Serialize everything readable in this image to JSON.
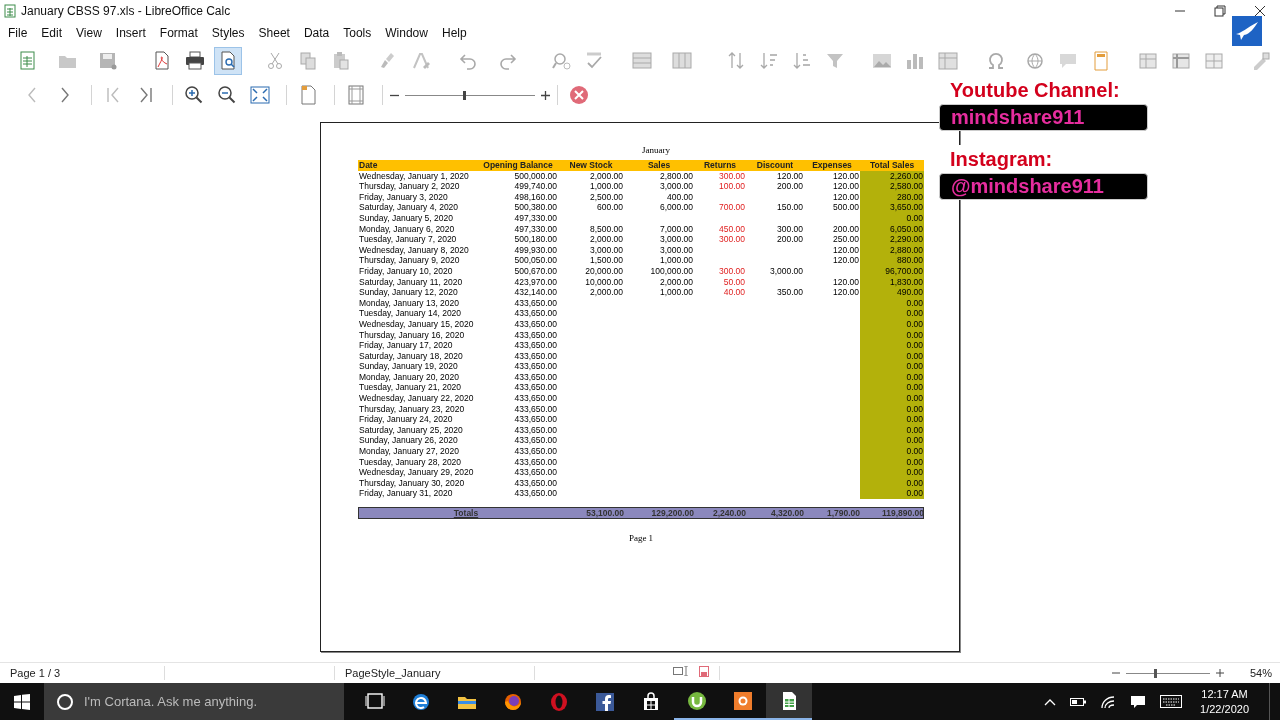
{
  "window": {
    "title": "January CBSS 97.xls - LibreOffice Calc"
  },
  "menu": [
    "File",
    "Edit",
    "View",
    "Insert",
    "Format",
    "Styles",
    "Sheet",
    "Data",
    "Tools",
    "Window",
    "Help"
  ],
  "zoom_toolbar": {
    "level": 0.45
  },
  "preview": {
    "sheet_title": "January",
    "columns": [
      "Date",
      "Opening Balance",
      "New Stock",
      "Sales",
      "Returns",
      "Discount",
      "Expenses",
      "Total Sales"
    ],
    "rows": [
      {
        "date": "Wednesday, January 1, 2020",
        "opening": "500,000.00",
        "new_stock": "2,000.00",
        "sales": "2,800.00",
        "returns": "300.00",
        "discount": "120.00",
        "expenses": "120.00",
        "total": "2,260.00"
      },
      {
        "date": "Thursday, January 2, 2020",
        "opening": "499,740.00",
        "new_stock": "1,000.00",
        "sales": "3,000.00",
        "returns": "100.00",
        "discount": "200.00",
        "expenses": "120.00",
        "total": "2,580.00"
      },
      {
        "date": "Friday, January 3, 2020",
        "opening": "498,160.00",
        "new_stock": "2,500.00",
        "sales": "400.00",
        "expenses": "120.00",
        "total": "280.00"
      },
      {
        "date": "Saturday, January 4, 2020",
        "opening": "500,380.00",
        "new_stock": "600.00",
        "sales": "6,000.00",
        "returns": "700.00",
        "discount": "150.00",
        "expenses": "500.00",
        "total": "3,650.00"
      },
      {
        "date": "Sunday, January 5, 2020",
        "opening": "497,330.00",
        "total": "0.00"
      },
      {
        "date": "Monday, January 6, 2020",
        "opening": "497,330.00",
        "new_stock": "8,500.00",
        "sales": "7,000.00",
        "returns": "450.00",
        "discount": "300.00",
        "expenses": "200.00",
        "total": "6,050.00"
      },
      {
        "date": "Tuesday, January 7, 2020",
        "opening": "500,180.00",
        "new_stock": "2,000.00",
        "sales": "3,000.00",
        "returns": "300.00",
        "discount": "200.00",
        "expenses": "250.00",
        "total": "2,290.00"
      },
      {
        "date": "Wednesday, January 8, 2020",
        "opening": "499,930.00",
        "new_stock": "3,000.00",
        "sales": "3,000.00",
        "expenses": "120.00",
        "total": "2,880.00"
      },
      {
        "date": "Thursday, January 9, 2020",
        "opening": "500,050.00",
        "new_stock": "1,500.00",
        "sales": "1,000.00",
        "expenses": "120.00",
        "total": "880.00"
      },
      {
        "date": "Friday, January 10, 2020",
        "opening": "500,670.00",
        "new_stock": "20,000.00",
        "sales": "100,000.00",
        "returns": "300.00",
        "discount": "3,000.00",
        "total": "96,700.00"
      },
      {
        "date": "Saturday, January 11, 2020",
        "opening": "423,970.00",
        "new_stock": "10,000.00",
        "sales": "2,000.00",
        "returns": "50.00",
        "expenses": "120.00",
        "total": "1,830.00"
      },
      {
        "date": "Sunday, January 12, 2020",
        "opening": "432,140.00",
        "new_stock": "2,000.00",
        "sales": "1,000.00",
        "returns": "40.00",
        "discount": "350.00",
        "expenses": "120.00",
        "total": "490.00"
      },
      {
        "date": "Monday, January 13, 2020",
        "opening": "433,650.00",
        "total": "0.00"
      },
      {
        "date": "Tuesday, January 14, 2020",
        "opening": "433,650.00",
        "total": "0.00"
      },
      {
        "date": "Wednesday, January 15, 2020",
        "opening": "433,650.00",
        "total": "0.00"
      },
      {
        "date": "Thursday, January 16, 2020",
        "opening": "433,650.00",
        "total": "0.00"
      },
      {
        "date": "Friday, January 17, 2020",
        "opening": "433,650.00",
        "total": "0.00"
      },
      {
        "date": "Saturday, January 18, 2020",
        "opening": "433,650.00",
        "total": "0.00"
      },
      {
        "date": "Sunday, January 19, 2020",
        "opening": "433,650.00",
        "total": "0.00"
      },
      {
        "date": "Monday, January 20, 2020",
        "opening": "433,650.00",
        "total": "0.00"
      },
      {
        "date": "Tuesday, January 21, 2020",
        "opening": "433,650.00",
        "total": "0.00"
      },
      {
        "date": "Wednesday, January 22, 2020",
        "opening": "433,650.00",
        "total": "0.00"
      },
      {
        "date": "Thursday, January 23, 2020",
        "opening": "433,650.00",
        "total": "0.00"
      },
      {
        "date": "Friday, January 24, 2020",
        "opening": "433,650.00",
        "total": "0.00"
      },
      {
        "date": "Saturday, January 25, 2020",
        "opening": "433,650.00",
        "total": "0.00"
      },
      {
        "date": "Sunday, January 26, 2020",
        "opening": "433,650.00",
        "total": "0.00"
      },
      {
        "date": "Monday, January 27, 2020",
        "opening": "433,650.00",
        "total": "0.00"
      },
      {
        "date": "Tuesday, January 28, 2020",
        "opening": "433,650.00",
        "total": "0.00"
      },
      {
        "date": "Wednesday, January 29, 2020",
        "opening": "433,650.00",
        "total": "0.00"
      },
      {
        "date": "Thursday, January 30, 2020",
        "opening": "433,650.00",
        "total": "0.00"
      },
      {
        "date": "Friday, January 31, 2020",
        "opening": "433,650.00",
        "total": "0.00"
      }
    ],
    "totals": {
      "label": "Totals",
      "new_stock": "53,100.00",
      "sales": "129,200.00",
      "returns": "2,240.00",
      "discount": "4,320.00",
      "expenses": "1,790.00",
      "total": "119,890.00"
    },
    "footer": "Page 1"
  },
  "overlay": {
    "youtube_label": "Youtube Channel:",
    "youtube_handle": "mindshare911",
    "instagram_label": "Instagram:",
    "instagram_handle": "@mindshare911"
  },
  "status_bar": {
    "page": "Page 1 / 3",
    "page_style": "PageStyle_January",
    "zoom": "54%",
    "zoom_slider": {
      "level": 0.35
    }
  },
  "taskbar": {
    "search_placeholder": "I'm Cortana. Ask me anything.",
    "time": "12:17 AM",
    "date": "1/22/2020"
  }
}
